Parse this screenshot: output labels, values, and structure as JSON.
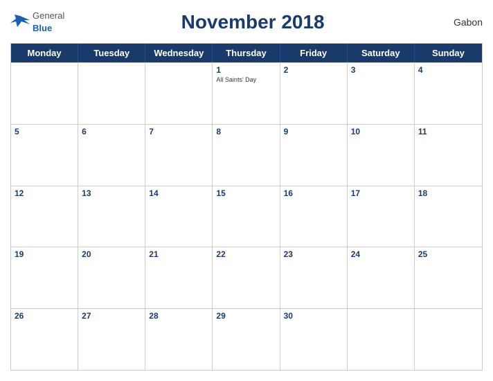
{
  "header": {
    "logo_general": "General",
    "logo_blue": "Blue",
    "title": "November 2018",
    "country": "Gabon"
  },
  "day_headers": [
    "Monday",
    "Tuesday",
    "Wednesday",
    "Thursday",
    "Friday",
    "Saturday",
    "Sunday"
  ],
  "weeks": [
    [
      {
        "day": "",
        "empty": true
      },
      {
        "day": "",
        "empty": true
      },
      {
        "day": "",
        "empty": true
      },
      {
        "day": "1",
        "holiday": "All Saints' Day"
      },
      {
        "day": "2"
      },
      {
        "day": "3"
      },
      {
        "day": "4"
      }
    ],
    [
      {
        "day": "5"
      },
      {
        "day": "6"
      },
      {
        "day": "7"
      },
      {
        "day": "8"
      },
      {
        "day": "9"
      },
      {
        "day": "10"
      },
      {
        "day": "11"
      }
    ],
    [
      {
        "day": "12"
      },
      {
        "day": "13"
      },
      {
        "day": "14"
      },
      {
        "day": "15"
      },
      {
        "day": "16"
      },
      {
        "day": "17"
      },
      {
        "day": "18"
      }
    ],
    [
      {
        "day": "19"
      },
      {
        "day": "20"
      },
      {
        "day": "21"
      },
      {
        "day": "22"
      },
      {
        "day": "23"
      },
      {
        "day": "24"
      },
      {
        "day": "25"
      }
    ],
    [
      {
        "day": "26"
      },
      {
        "day": "27"
      },
      {
        "day": "28"
      },
      {
        "day": "29"
      },
      {
        "day": "30"
      },
      {
        "day": "",
        "empty": true
      },
      {
        "day": "",
        "empty": true
      }
    ]
  ]
}
